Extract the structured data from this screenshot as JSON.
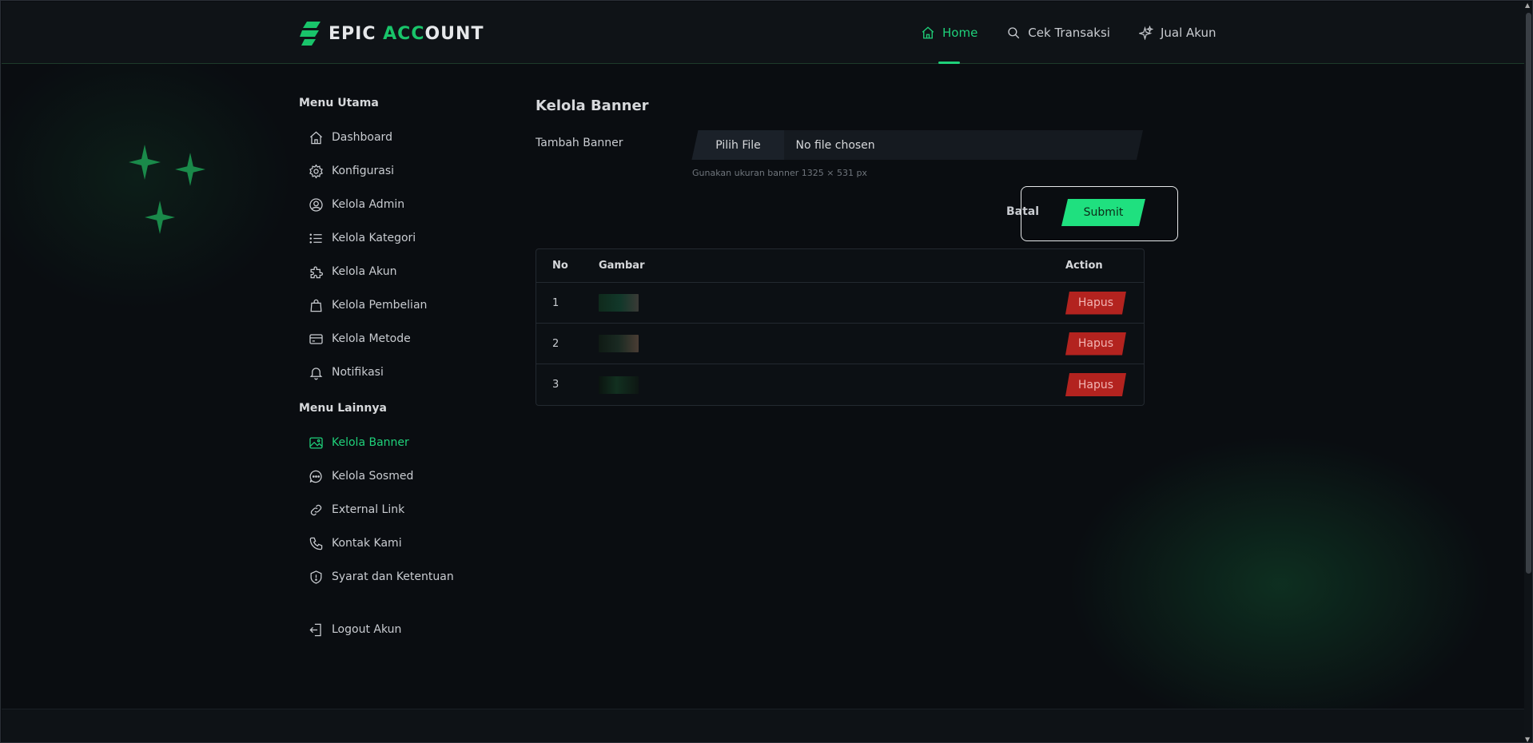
{
  "brand": {
    "part1": "EPIC ",
    "part2": "ACC",
    "part3": "OUNT",
    "accent": "#19c46a"
  },
  "nav": {
    "home": "Home",
    "cek_transaksi": "Cek Transaksi",
    "jual_akun": "Jual Akun"
  },
  "sidebar": {
    "menu_utama": "Menu Utama",
    "items_main": [
      {
        "label": "Dashboard",
        "icon": "home-icon"
      },
      {
        "label": "Konfigurasi",
        "icon": "gear-icon"
      },
      {
        "label": "Kelola Admin",
        "icon": "user-circle-icon"
      },
      {
        "label": "Kelola Kategori",
        "icon": "list-icon"
      },
      {
        "label": "Kelola Akun",
        "icon": "puzzle-icon"
      },
      {
        "label": "Kelola Pembelian",
        "icon": "shopping-bag-icon"
      },
      {
        "label": "Kelola Metode",
        "icon": "credit-card-icon"
      },
      {
        "label": "Notifikasi",
        "icon": "bell-icon"
      }
    ],
    "menu_lainnya": "Menu Lainnya",
    "items_other": [
      {
        "label": "Kelola Banner",
        "icon": "image-icon",
        "active": true
      },
      {
        "label": "Kelola Sosmed",
        "icon": "chat-icon"
      },
      {
        "label": "External Link",
        "icon": "link-icon"
      },
      {
        "label": "Kontak Kami",
        "icon": "phone-icon"
      },
      {
        "label": "Syarat dan Ketentuan",
        "icon": "shield-icon"
      }
    ],
    "logout": "Logout Akun"
  },
  "main": {
    "title": "Kelola Banner",
    "form": {
      "label": "Tambah Banner",
      "file_button": "Pilih File",
      "file_status": "No file chosen",
      "hint": "Gunakan ukuran banner 1325 × 531 px",
      "cancel": "Batal",
      "submit": "Submit"
    },
    "table": {
      "headers": {
        "no": "No",
        "gambar": "Gambar",
        "action": "Action"
      },
      "rows": [
        {
          "no": "1",
          "action": "Hapus"
        },
        {
          "no": "2",
          "action": "Hapus"
        },
        {
          "no": "3",
          "action": "Hapus"
        }
      ]
    }
  },
  "colors": {
    "accent": "#1fd17a",
    "submit": "#1fe07f",
    "danger": "#b3231f",
    "background": "#0a0d11"
  }
}
